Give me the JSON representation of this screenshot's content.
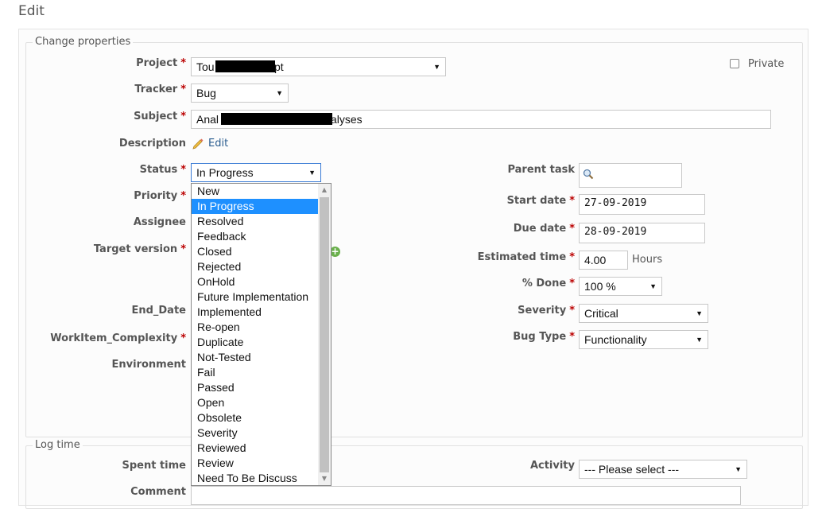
{
  "page": {
    "title": "Edit"
  },
  "change_properties": {
    "legend": "Change properties",
    "project": {
      "label": "Project",
      "value_start": "Tou",
      "value_end": "pt",
      "required": "*"
    },
    "private": {
      "label": "Private",
      "checked": false
    },
    "tracker": {
      "label": "Tracker",
      "value": "Bug",
      "required": "*"
    },
    "subject": {
      "label": "Subject",
      "value_start": "Anal",
      "value_end": "alyses",
      "required": "*"
    },
    "description": {
      "label": "Description",
      "edit_link": "Edit"
    },
    "status": {
      "label": "Status",
      "value": "In Progress",
      "required": "*"
    },
    "priority": {
      "label": "Priority",
      "required": "*"
    },
    "assignee": {
      "label": "Assignee"
    },
    "target_version": {
      "label": "Target version",
      "required": "*"
    },
    "end_date": {
      "label": "End_Date"
    },
    "workitem_complexity": {
      "label": "WorkItem_Complexity",
      "required": "*"
    },
    "environment": {
      "label": "Environment"
    },
    "parent_task": {
      "label": "Parent task",
      "value": ""
    },
    "start_date": {
      "label": "Start date",
      "value": "27-09-2019",
      "required": "*"
    },
    "due_date": {
      "label": "Due date",
      "value": "28-09-2019",
      "required": "*"
    },
    "estimated_time": {
      "label": "Estimated time",
      "value": "4.00",
      "unit": "Hours",
      "required": "*"
    },
    "done": {
      "label": "% Done",
      "value": "100 %",
      "required": "*"
    },
    "severity": {
      "label": "Severity",
      "value": "Critical",
      "required": "*"
    },
    "bug_type": {
      "label": "Bug Type",
      "value": "Functionality",
      "required": "*"
    }
  },
  "status_dropdown": {
    "options": [
      "New",
      "In Progress",
      "Resolved",
      "Feedback",
      "Closed",
      "Rejected",
      "OnHold",
      "Future Implementation",
      "Implemented",
      "Re-open",
      "Duplicate",
      "Not-Tested",
      "Fail",
      "Passed",
      "Open",
      "Obsolete",
      "Severity",
      "Reviewed",
      "Review",
      "Need To Be Discuss"
    ],
    "selected": "In Progress"
  },
  "log_time": {
    "legend": "Log time",
    "spent_time": {
      "label": "Spent time"
    },
    "activity": {
      "label": "Activity",
      "value": "--- Please select ---"
    },
    "comment": {
      "label": "Comment"
    }
  }
}
